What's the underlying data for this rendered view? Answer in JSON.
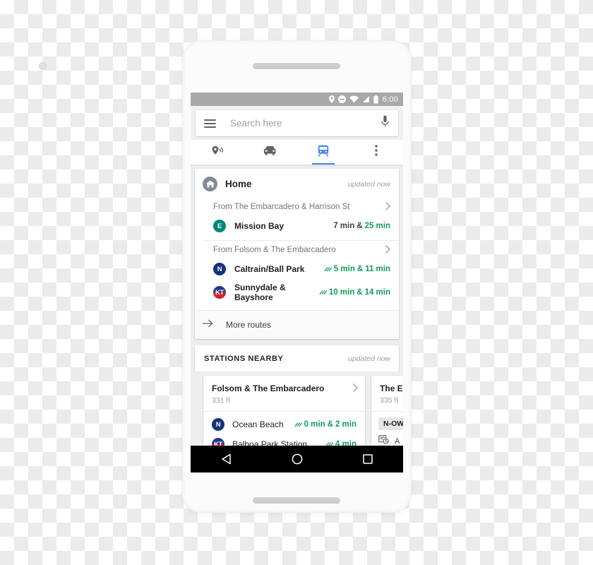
{
  "status_bar": {
    "icons": [
      "location-pin-icon",
      "do-not-disturb-icon",
      "wifi-icon",
      "signal-icon",
      "battery-icon"
    ],
    "time": "6:00"
  },
  "search": {
    "placeholder": "Search here",
    "menu_icon": "hamburger-menu-icon",
    "mic_icon": "microphone-icon"
  },
  "tabs": [
    {
      "name": "explore",
      "icon": "places-pin-icon",
      "active": false
    },
    {
      "name": "driving",
      "icon": "car-icon",
      "active": false
    },
    {
      "name": "transit",
      "icon": "train-icon",
      "active": true
    },
    {
      "name": "more",
      "icon": "overflow-menu-icon",
      "active": false
    }
  ],
  "accent_color": "#4285f4",
  "live_color": "#0f9d58",
  "home_card": {
    "icon": "home-icon",
    "title": "Home",
    "updated": "updated now",
    "groups": [
      {
        "origin": "From The Embarcadero & Harrison St",
        "routes": [
          {
            "badge": "E",
            "badge_color": "#00857a",
            "name": "Mission Bay",
            "live": false,
            "time_first": "7 min",
            "time_sep": "&",
            "time_second": "25 min"
          }
        ]
      },
      {
        "origin": "From Folsom & The Embarcadero",
        "routes": [
          {
            "badge": "N",
            "badge_color": "#17337e",
            "name": "Caltrain/Ball Park",
            "live": true,
            "time_first": "5 min",
            "time_sep": "&",
            "time_second": "11 min"
          },
          {
            "badge": "KT",
            "badge_color": "#d1212e",
            "name": "Sunnydale & Bayshore",
            "live": true,
            "time_first": "10 min",
            "time_sep": "&",
            "time_second": "14 min"
          }
        ]
      }
    ],
    "more_routes": {
      "icon": "arrow-right-icon",
      "label": "More routes"
    }
  },
  "stations_nearby": {
    "title": "STATIONS NEARBY",
    "updated": "updated now",
    "cards": [
      {
        "name": "Folsom & The Embarcadero",
        "distance": "331 ft",
        "chevron": "chevron-right-icon",
        "routes": [
          {
            "badge": "N",
            "badge_color": "#17337e",
            "name": "Ocean Beach",
            "live": true,
            "time_first": "0 min",
            "time_sep": "&",
            "time_second": "2 min"
          },
          {
            "badge": "KT",
            "badge_color": "#d1212e",
            "name": "Balboa Park Station",
            "live": true,
            "time_first": "",
            "time_sep": "",
            "time_second": "4 min"
          }
        ]
      },
      {
        "name": "The Em",
        "distance": "335 ft",
        "chip": "N-OW",
        "schedule_icon": "schedule-icon",
        "schedule_text": "A"
      }
    ]
  },
  "nav_bar": {
    "back_icon": "back-triangle-icon",
    "home_icon": "home-circle-icon",
    "recents_icon": "recents-square-icon"
  }
}
